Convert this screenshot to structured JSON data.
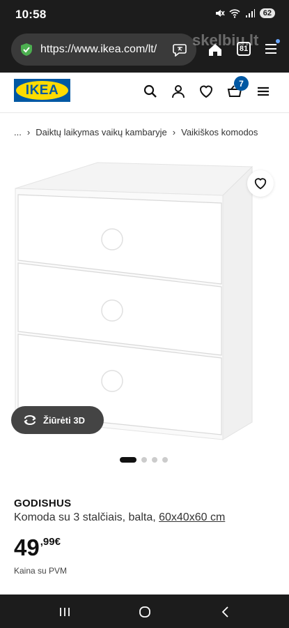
{
  "status_bar": {
    "time": "10:58",
    "battery": "62",
    "icons": [
      "mute-icon",
      "wifi-icon",
      "signal-icon",
      "battery-icon"
    ]
  },
  "browser": {
    "url": "https://www.ikea.com/lt/",
    "tabs_count": "81",
    "watermark": "skelbiu.lt",
    "icons": [
      "shield-check-icon",
      "translate-icon",
      "home-icon",
      "menu-icon"
    ]
  },
  "header": {
    "logo_text": "IKEA",
    "cart_count": "7",
    "icons": [
      "search-icon",
      "user-icon",
      "heart-icon",
      "cart-icon",
      "hamburger-icon"
    ]
  },
  "breadcrumb": {
    "items": [
      "...",
      "Daiktų laikymas vaikų kambaryje",
      "Vaikiškos komodos"
    ]
  },
  "gallery": {
    "view3d_label": "Žiūrėti 3D",
    "image_count": 4,
    "active_index": 0
  },
  "product": {
    "name": "GODISHUS",
    "description": "Komoda su 3 stalčiais, balta, ",
    "dimensions": "60x40x60 cm",
    "price_integer": "49",
    "price_cents": ",99€",
    "price_note": "Kaina su PVM"
  },
  "colors": {
    "ikea_blue": "#0058a3",
    "ikea_yellow": "#ffdb00",
    "dark_bar": "#1c1c1c"
  }
}
